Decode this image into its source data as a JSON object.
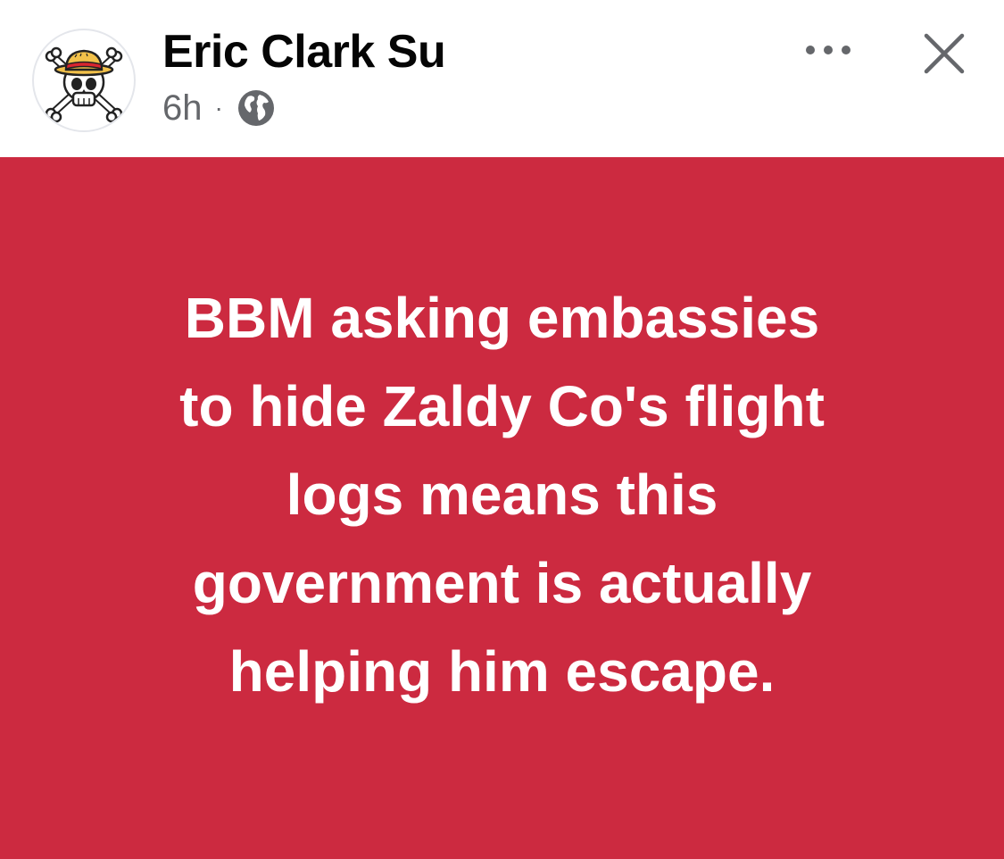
{
  "post": {
    "author": {
      "name": "Eric Clark Su",
      "avatar_icon": "straw-hat-jolly-roger-icon"
    },
    "timestamp": "6h",
    "separator": "·",
    "audience_icon": "globe-icon",
    "more_icon": "more-options-icon",
    "close_icon": "close-icon",
    "text": "BBM asking embassies\nto hide Zaldy Co's flight\nlogs means this\ngovernment is actually\nhelping him escape.",
    "colors": {
      "background": "#cc2a40",
      "text": "#ffffff",
      "name": "#050505",
      "meta": "#65676b"
    }
  }
}
